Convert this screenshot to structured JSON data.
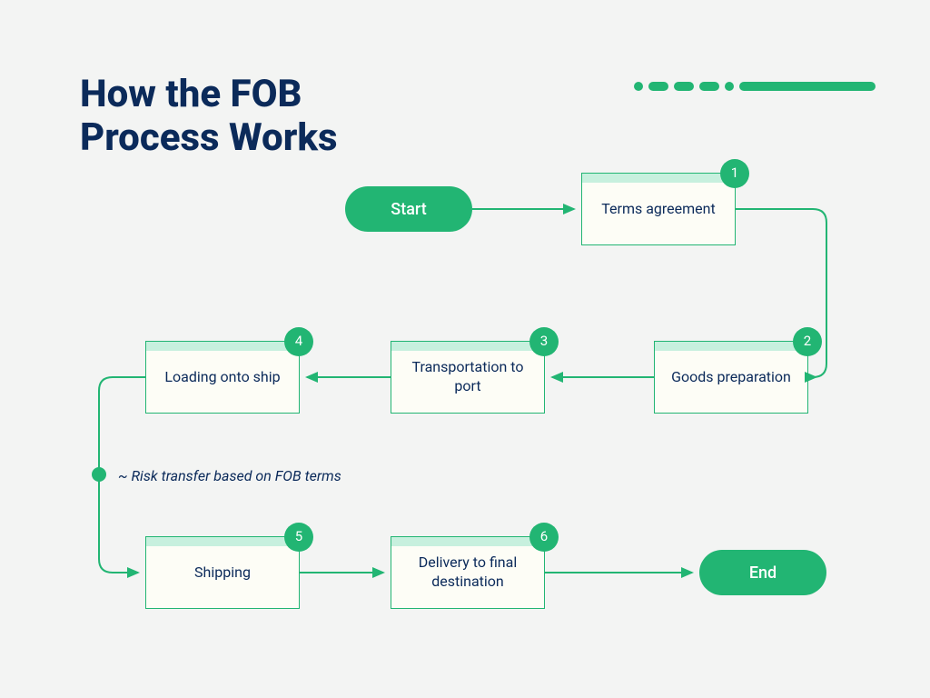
{
  "title": "How the FOB\nProcess Works",
  "start_label": "Start",
  "end_label": "End",
  "note": "~ Risk transfer based on FOB terms",
  "steps": [
    {
      "num": "1",
      "label": "Terms agreement"
    },
    {
      "num": "2",
      "label": "Goods preparation"
    },
    {
      "num": "3",
      "label": "Transportation to port"
    },
    {
      "num": "4",
      "label": "Loading onto ship"
    },
    {
      "num": "5",
      "label": "Shipping"
    },
    {
      "num": "6",
      "label": "Delivery to final destination"
    }
  ],
  "colors": {
    "accent": "#22b573",
    "dark": "#0b2a5a",
    "bg": "#f3f4f3"
  }
}
